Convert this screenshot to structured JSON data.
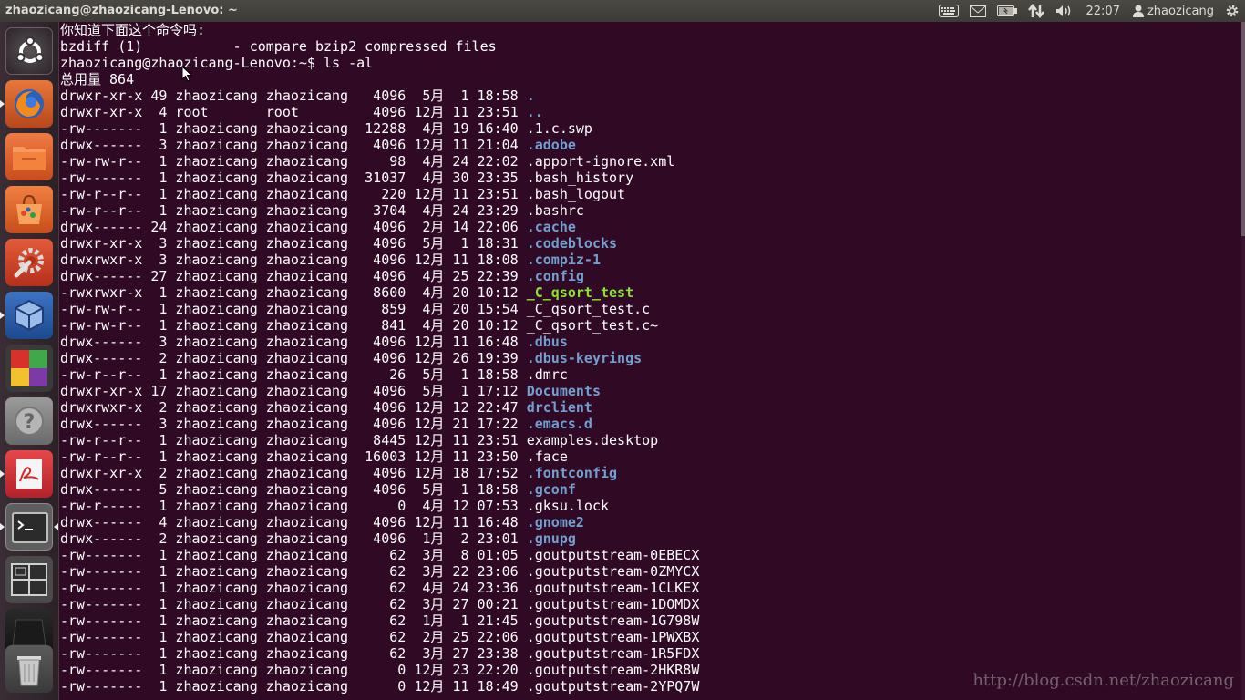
{
  "window": {
    "title": "zhaozicang@zhaozicang-Lenovo: ~"
  },
  "panel": {
    "clock": "22:07",
    "user": "zhaozicang"
  },
  "launcher": {
    "items": [
      {
        "name": "dash-button",
        "icon": "ubuntu-logo-icon"
      },
      {
        "name": "firefox-launcher",
        "icon": "firefox-icon"
      },
      {
        "name": "files-launcher",
        "icon": "folder-icon"
      },
      {
        "name": "software-center-launcher",
        "icon": "shopping-bag-icon"
      },
      {
        "name": "system-settings-launcher",
        "icon": "settings-wrench-icon"
      },
      {
        "name": "virtualbox-launcher",
        "icon": "virtualbox-icon"
      },
      {
        "name": "codeblocks-launcher",
        "icon": "codeblocks-icon"
      },
      {
        "name": "help-launcher",
        "icon": "question-mark-icon"
      },
      {
        "name": "pdf-reader-launcher",
        "icon": "pdf-reader-icon"
      },
      {
        "name": "terminal-launcher",
        "icon": "terminal-icon"
      },
      {
        "name": "workspace-switcher-launcher",
        "icon": "workspace-switcher-icon"
      },
      {
        "name": "dark-app-launcher",
        "icon": "dark-app-icon"
      },
      {
        "name": "trash-launcher",
        "icon": "trash-icon"
      }
    ]
  },
  "terminal": {
    "lines": [
      {
        "text": "你知道下面这个命令吗:"
      },
      {
        "text": "bzdiff (1)           - compare bzip2 compressed files"
      },
      {
        "text": "zhaozicang@zhaozicang-Lenovo:~$ ls -al"
      },
      {
        "text": "总用量 864"
      }
    ],
    "listing": [
      {
        "meta": "drwxr-xr-x 49 zhaozicang zhaozicang   4096  5月  1 18:58 ",
        "name": ".",
        "kind": "dir"
      },
      {
        "meta": "drwxr-xr-x  4 root       root         4096 12月 11 23:51 ",
        "name": "..",
        "kind": "dir"
      },
      {
        "meta": "-rw-------  1 zhaozicang zhaozicang  12288  4月 19 16:40 ",
        "name": ".1.c.swp",
        "kind": "file"
      },
      {
        "meta": "drwx------  3 zhaozicang zhaozicang   4096 12月 11 21:04 ",
        "name": ".adobe",
        "kind": "dir"
      },
      {
        "meta": "-rw-rw-r--  1 zhaozicang zhaozicang     98  4月 24 22:02 ",
        "name": ".apport-ignore.xml",
        "kind": "file"
      },
      {
        "meta": "-rw-------  1 zhaozicang zhaozicang  31037  4月 30 23:35 ",
        "name": ".bash_history",
        "kind": "file"
      },
      {
        "meta": "-rw-r--r--  1 zhaozicang zhaozicang    220 12月 11 23:51 ",
        "name": ".bash_logout",
        "kind": "file"
      },
      {
        "meta": "-rw-r--r--  1 zhaozicang zhaozicang   3704  4月 24 23:29 ",
        "name": ".bashrc",
        "kind": "file"
      },
      {
        "meta": "drwx------ 24 zhaozicang zhaozicang   4096  2月 14 22:06 ",
        "name": ".cache",
        "kind": "dir"
      },
      {
        "meta": "drwxr-xr-x  3 zhaozicang zhaozicang   4096  5月  1 18:31 ",
        "name": ".codeblocks",
        "kind": "dir"
      },
      {
        "meta": "drwxrwxr-x  3 zhaozicang zhaozicang   4096 12月 11 18:08 ",
        "name": ".compiz-1",
        "kind": "dir"
      },
      {
        "meta": "drwx------ 27 zhaozicang zhaozicang   4096  4月 25 22:39 ",
        "name": ".config",
        "kind": "dir"
      },
      {
        "meta": "-rwxrwxr-x  1 zhaozicang zhaozicang   8600  4月 20 10:12 ",
        "name": "_C_qsort_test",
        "kind": "exe"
      },
      {
        "meta": "-rw-rw-r--  1 zhaozicang zhaozicang    859  4月 20 15:54 ",
        "name": "_C_qsort_test.c",
        "kind": "file"
      },
      {
        "meta": "-rw-rw-r--  1 zhaozicang zhaozicang    841  4月 20 10:12 ",
        "name": "_C_qsort_test.c~",
        "kind": "file"
      },
      {
        "meta": "drwx------  3 zhaozicang zhaozicang   4096 12月 11 16:48 ",
        "name": ".dbus",
        "kind": "dir"
      },
      {
        "meta": "drwx------  2 zhaozicang zhaozicang   4096 12月 26 19:39 ",
        "name": ".dbus-keyrings",
        "kind": "dir"
      },
      {
        "meta": "-rw-r--r--  1 zhaozicang zhaozicang     26  5月  1 18:58 ",
        "name": ".dmrc",
        "kind": "file"
      },
      {
        "meta": "drwxr-xr-x 17 zhaozicang zhaozicang   4096  5月  1 17:12 ",
        "name": "Documents",
        "kind": "dir"
      },
      {
        "meta": "drwxrwxr-x  2 zhaozicang zhaozicang   4096 12月 12 22:47 ",
        "name": "drclient",
        "kind": "dir"
      },
      {
        "meta": "drwx------  3 zhaozicang zhaozicang   4096 12月 21 17:22 ",
        "name": ".emacs.d",
        "kind": "dir"
      },
      {
        "meta": "-rw-r--r--  1 zhaozicang zhaozicang   8445 12月 11 23:51 ",
        "name": "examples.desktop",
        "kind": "file"
      },
      {
        "meta": "-rw-r--r--  1 zhaozicang zhaozicang  16003 12月 11 23:50 ",
        "name": ".face",
        "kind": "file"
      },
      {
        "meta": "drwxr-xr-x  2 zhaozicang zhaozicang   4096 12月 18 17:52 ",
        "name": ".fontconfig",
        "kind": "dir"
      },
      {
        "meta": "drwx------  5 zhaozicang zhaozicang   4096  5月  1 18:58 ",
        "name": ".gconf",
        "kind": "dir"
      },
      {
        "meta": "-rw-r-----  1 zhaozicang zhaozicang      0  4月 12 07:53 ",
        "name": ".gksu.lock",
        "kind": "file"
      },
      {
        "meta": "drwx------  4 zhaozicang zhaozicang   4096 12月 11 16:48 ",
        "name": ".gnome2",
        "kind": "dir"
      },
      {
        "meta": "drwx------  2 zhaozicang zhaozicang   4096  1月  2 23:01 ",
        "name": ".gnupg",
        "kind": "dir"
      },
      {
        "meta": "-rw-------  1 zhaozicang zhaozicang     62  3月  8 01:05 ",
        "name": ".goutputstream-0EBECX",
        "kind": "file"
      },
      {
        "meta": "-rw-------  1 zhaozicang zhaozicang     62  3月 22 23:06 ",
        "name": ".goutputstream-0ZMYCX",
        "kind": "file"
      },
      {
        "meta": "-rw-------  1 zhaozicang zhaozicang     62  4月 24 23:36 ",
        "name": ".goutputstream-1CLKEX",
        "kind": "file"
      },
      {
        "meta": "-rw-------  1 zhaozicang zhaozicang     62  3月 27 00:21 ",
        "name": ".goutputstream-1DOMDX",
        "kind": "file"
      },
      {
        "meta": "-rw-------  1 zhaozicang zhaozicang     62  1月  1 21:45 ",
        "name": ".goutputstream-1G798W",
        "kind": "file"
      },
      {
        "meta": "-rw-------  1 zhaozicang zhaozicang     62  2月 25 22:06 ",
        "name": ".goutputstream-1PWXBX",
        "kind": "file"
      },
      {
        "meta": "-rw-------  1 zhaozicang zhaozicang     62  3月 27 23:38 ",
        "name": ".goutputstream-1R5FDX",
        "kind": "file"
      },
      {
        "meta": "-rw-------  1 zhaozicang zhaozicang      0 12月 23 22:20 ",
        "name": ".goutputstream-2HKR8W",
        "kind": "file"
      },
      {
        "meta": "-rw-------  1 zhaozicang zhaozicang      0 12月 11 18:49 ",
        "name": ".goutputstream-2YPQ7W",
        "kind": "file"
      }
    ]
  },
  "watermark": "http://blog.csdn.net/zhaozicang",
  "colors": {
    "background": "#300a24",
    "text": "#ffffff",
    "directory": "#729fcf",
    "executable": "#8ae234"
  }
}
